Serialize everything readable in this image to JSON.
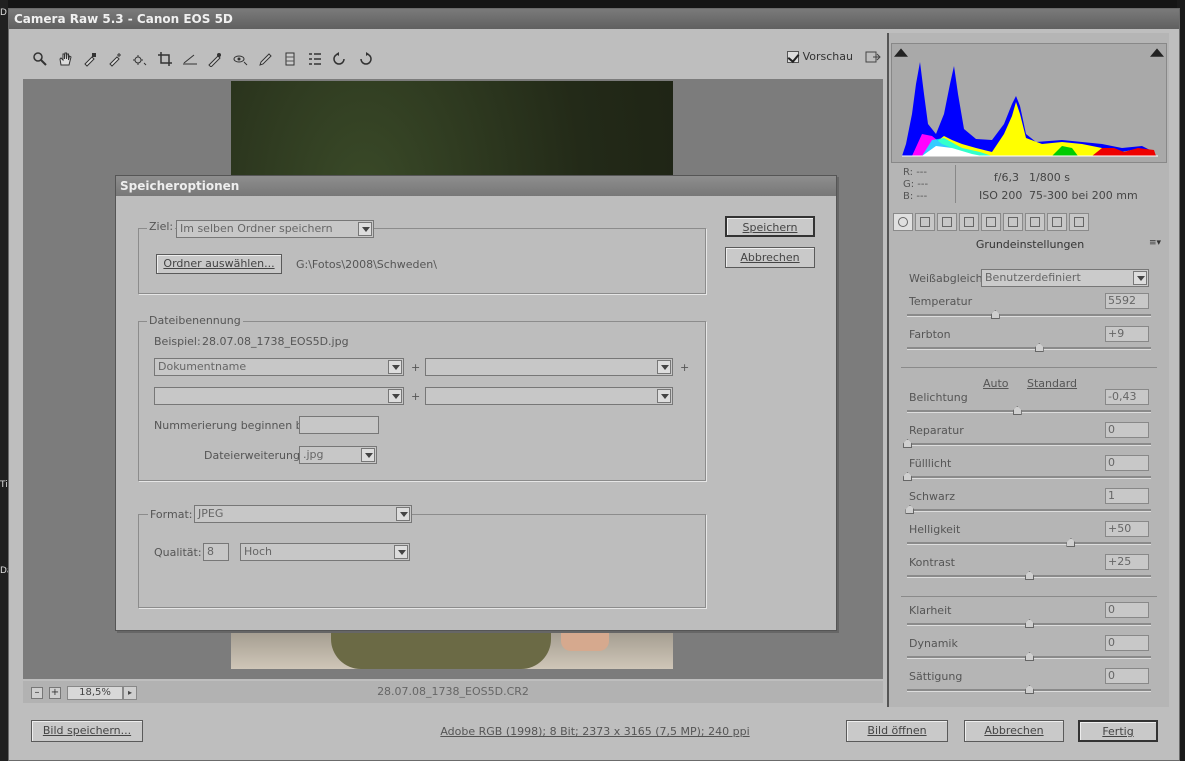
{
  "window": {
    "title": "Camera Raw 5.3 - Canon EOS 5D"
  },
  "toolbar": {
    "tools": [
      "zoom-icon",
      "hand-icon",
      "eyedropper-icon",
      "color-sampler-icon",
      "target-adjust-icon",
      "crop-icon",
      "straighten-icon",
      "spot-removal-icon",
      "red-eye-icon",
      "adjustment-brush-icon",
      "graduated-filter-icon",
      "preferences-icon",
      "rotate-left-icon",
      "rotate-right-icon"
    ],
    "preview_label": "Vorschau",
    "preview_checked": true
  },
  "status": {
    "zoom": "18,5%",
    "zoom_minus": "–",
    "zoom_plus": "+",
    "filename": "28.07.08_1738_EOS5D.CR2"
  },
  "histogram": {
    "rgb_r": "R:  ---",
    "rgb_g": "G:  ---",
    "rgb_b": "B:  ---",
    "aperture": "f/6,3",
    "shutter": "1/800 s",
    "iso": "ISO 200",
    "lens": "75-300 bei 200 mm"
  },
  "panel": {
    "title": "Grundeinstellungen",
    "menu_glyph": "≡▾",
    "wb_label": "Weißabgleich:",
    "wb_value": "Benutzerdefiniert",
    "auto": "Auto",
    "standard": "Standard",
    "controls": [
      {
        "label": "Temperatur",
        "value": "5592",
        "pos": 0.36
      },
      {
        "label": "Farbton",
        "value": "+9",
        "pos": 0.54
      },
      {
        "label": "Belichtung",
        "value": "-0,43",
        "pos": 0.45
      },
      {
        "label": "Reparatur",
        "value": "0",
        "pos": 0.0
      },
      {
        "label": "Fülllicht",
        "value": "0",
        "pos": 0.0
      },
      {
        "label": "Schwarz",
        "value": "1",
        "pos": 0.01
      },
      {
        "label": "Helligkeit",
        "value": "+50",
        "pos": 0.67
      },
      {
        "label": "Kontrast",
        "value": "+25",
        "pos": 0.5
      },
      {
        "label": "Klarheit",
        "value": "0",
        "pos": 0.5
      },
      {
        "label": "Dynamik",
        "value": "0",
        "pos": 0.5
      },
      {
        "label": "Sättigung",
        "value": "0",
        "pos": 0.5
      }
    ]
  },
  "bottom": {
    "save_image": "Bild speichern...",
    "color_info": "Adobe RGB (1998); 8 Bit; 2373 x 3165 (7,5 MP); 240 ppi",
    "open_image": "Bild öffnen",
    "cancel": "Abbrechen",
    "done": "Fertig"
  },
  "dialog": {
    "title": "Speicheroptionen",
    "save": "Speichern",
    "cancel": "Abbrechen",
    "target_label": "Ziel:",
    "target_value": "Im selben Ordner speichern",
    "choose_folder": "Ordner auswählen...",
    "folder_path": "G:\\Fotos\\2008\\Schweden\\",
    "naming_label": "Dateibenennung",
    "example_label": "Beispiel:",
    "example_value": "28.07.08_1738_EOS5D.jpg",
    "name_field1": "Dokumentname",
    "name_field2": "",
    "name_field3": "",
    "name_field4": "",
    "plus": "+",
    "numbering_label": "Nummerierung beginnen bei:",
    "numbering_value": "",
    "extension_label": "Dateierweiterung:",
    "extension_value": ".jpg",
    "format_label": "Format:",
    "format_value": "JPEG",
    "quality_label": "Qualität:",
    "quality_value": "8",
    "quality_level": "Hoch"
  }
}
